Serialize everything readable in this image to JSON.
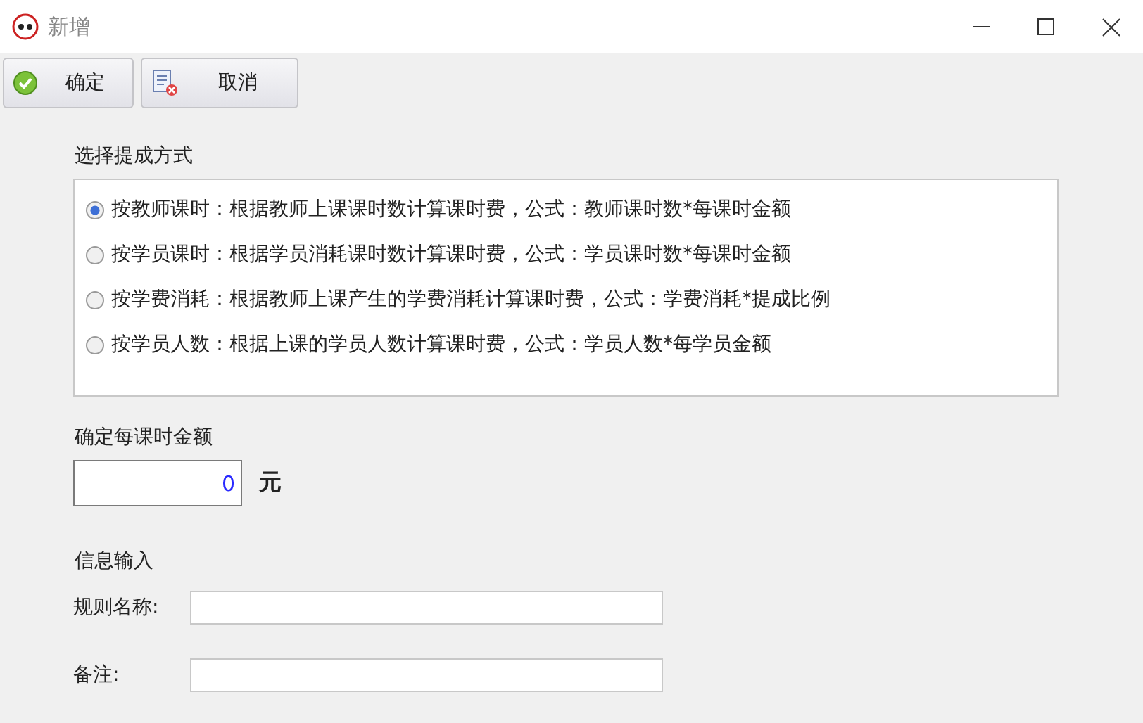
{
  "window": {
    "title": "新增"
  },
  "toolbar": [
    {
      "label": "确定",
      "kind": "confirm"
    },
    {
      "label": "取消",
      "kind": "cancel"
    }
  ],
  "method": {
    "label": "选择提成方式",
    "options": [
      {
        "label": "按教师课时：根据教师上课课时数计算课时费，公式：教师课时数*每课时金额",
        "selected": true
      },
      {
        "label": "按学员课时：根据学员消耗课时数计算课时费，公式：学员课时数*每课时金额",
        "selected": false
      },
      {
        "label": "按学费消耗：根据教师上课产生的学费消耗计算课时费，公式：学费消耗*提成比例",
        "selected": false
      },
      {
        "label": "按学员人数：根据上课的学员人数计算课时费，公式：学员人数*每学员金额",
        "selected": false
      }
    ]
  },
  "amount": {
    "label": "确定每课时金额",
    "value": "0",
    "unit": "元"
  },
  "info": {
    "label": "信息输入",
    "fields": [
      {
        "label": "规则名称:"
      },
      {
        "label": "备注:"
      }
    ]
  }
}
